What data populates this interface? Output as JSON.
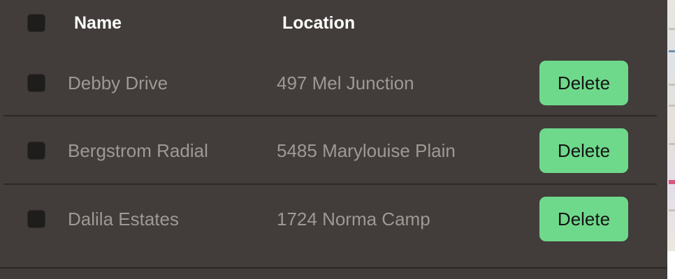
{
  "table": {
    "headers": {
      "name": "Name",
      "location": "Location"
    },
    "rows": [
      {
        "name": "Debby Drive",
        "location": "497 Mel Junction",
        "action": "Delete"
      },
      {
        "name": "Bergstrom Radial",
        "location": "5485 Marylouise Plain",
        "action": "Delete"
      },
      {
        "name": "Dalila Estates",
        "location": "1724 Norma Camp",
        "action": "Delete"
      }
    ]
  },
  "colors": {
    "background": "#423d3a",
    "delete_button": "#6fd98b",
    "checkbox": "#1f1d1c",
    "row_text": "#9e9995",
    "header_text": "#ffffff"
  }
}
